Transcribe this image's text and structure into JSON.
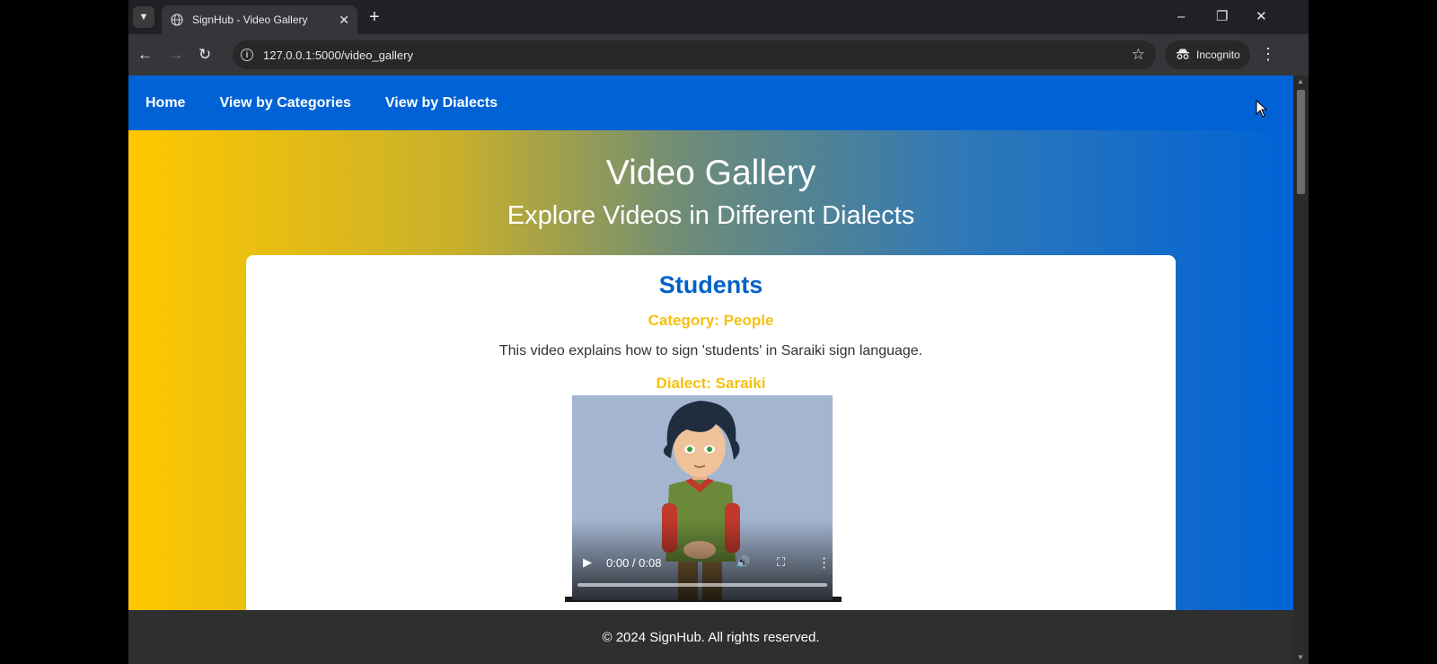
{
  "browser": {
    "tab": {
      "title": "SignHub - Video Gallery",
      "favicon": "globe-icon"
    },
    "url": "127.0.0.1:5000/video_gallery",
    "profile_label": "Incognito"
  },
  "site": {
    "nav": [
      {
        "label": "Home"
      },
      {
        "label": "View by Categories"
      },
      {
        "label": "View by Dialects"
      }
    ],
    "hero": {
      "title": "Video Gallery",
      "subtitle": "Explore Videos in Different Dialects"
    },
    "video_card": {
      "title": "Students",
      "category": "Category: People",
      "description": "This video explains how to sign 'students' in Saraiki sign language.",
      "dialect": "Dialect: Saraiki",
      "player": {
        "time": "0:00 / 0:08",
        "progress": 0
      }
    },
    "footer": "© 2024 SignHub. All rights reserved."
  },
  "colors": {
    "nav_blue": "#0062d4",
    "title_blue": "#0062c8",
    "accent_yellow": "#f5c010",
    "footer_bg": "#2f2f2f"
  }
}
